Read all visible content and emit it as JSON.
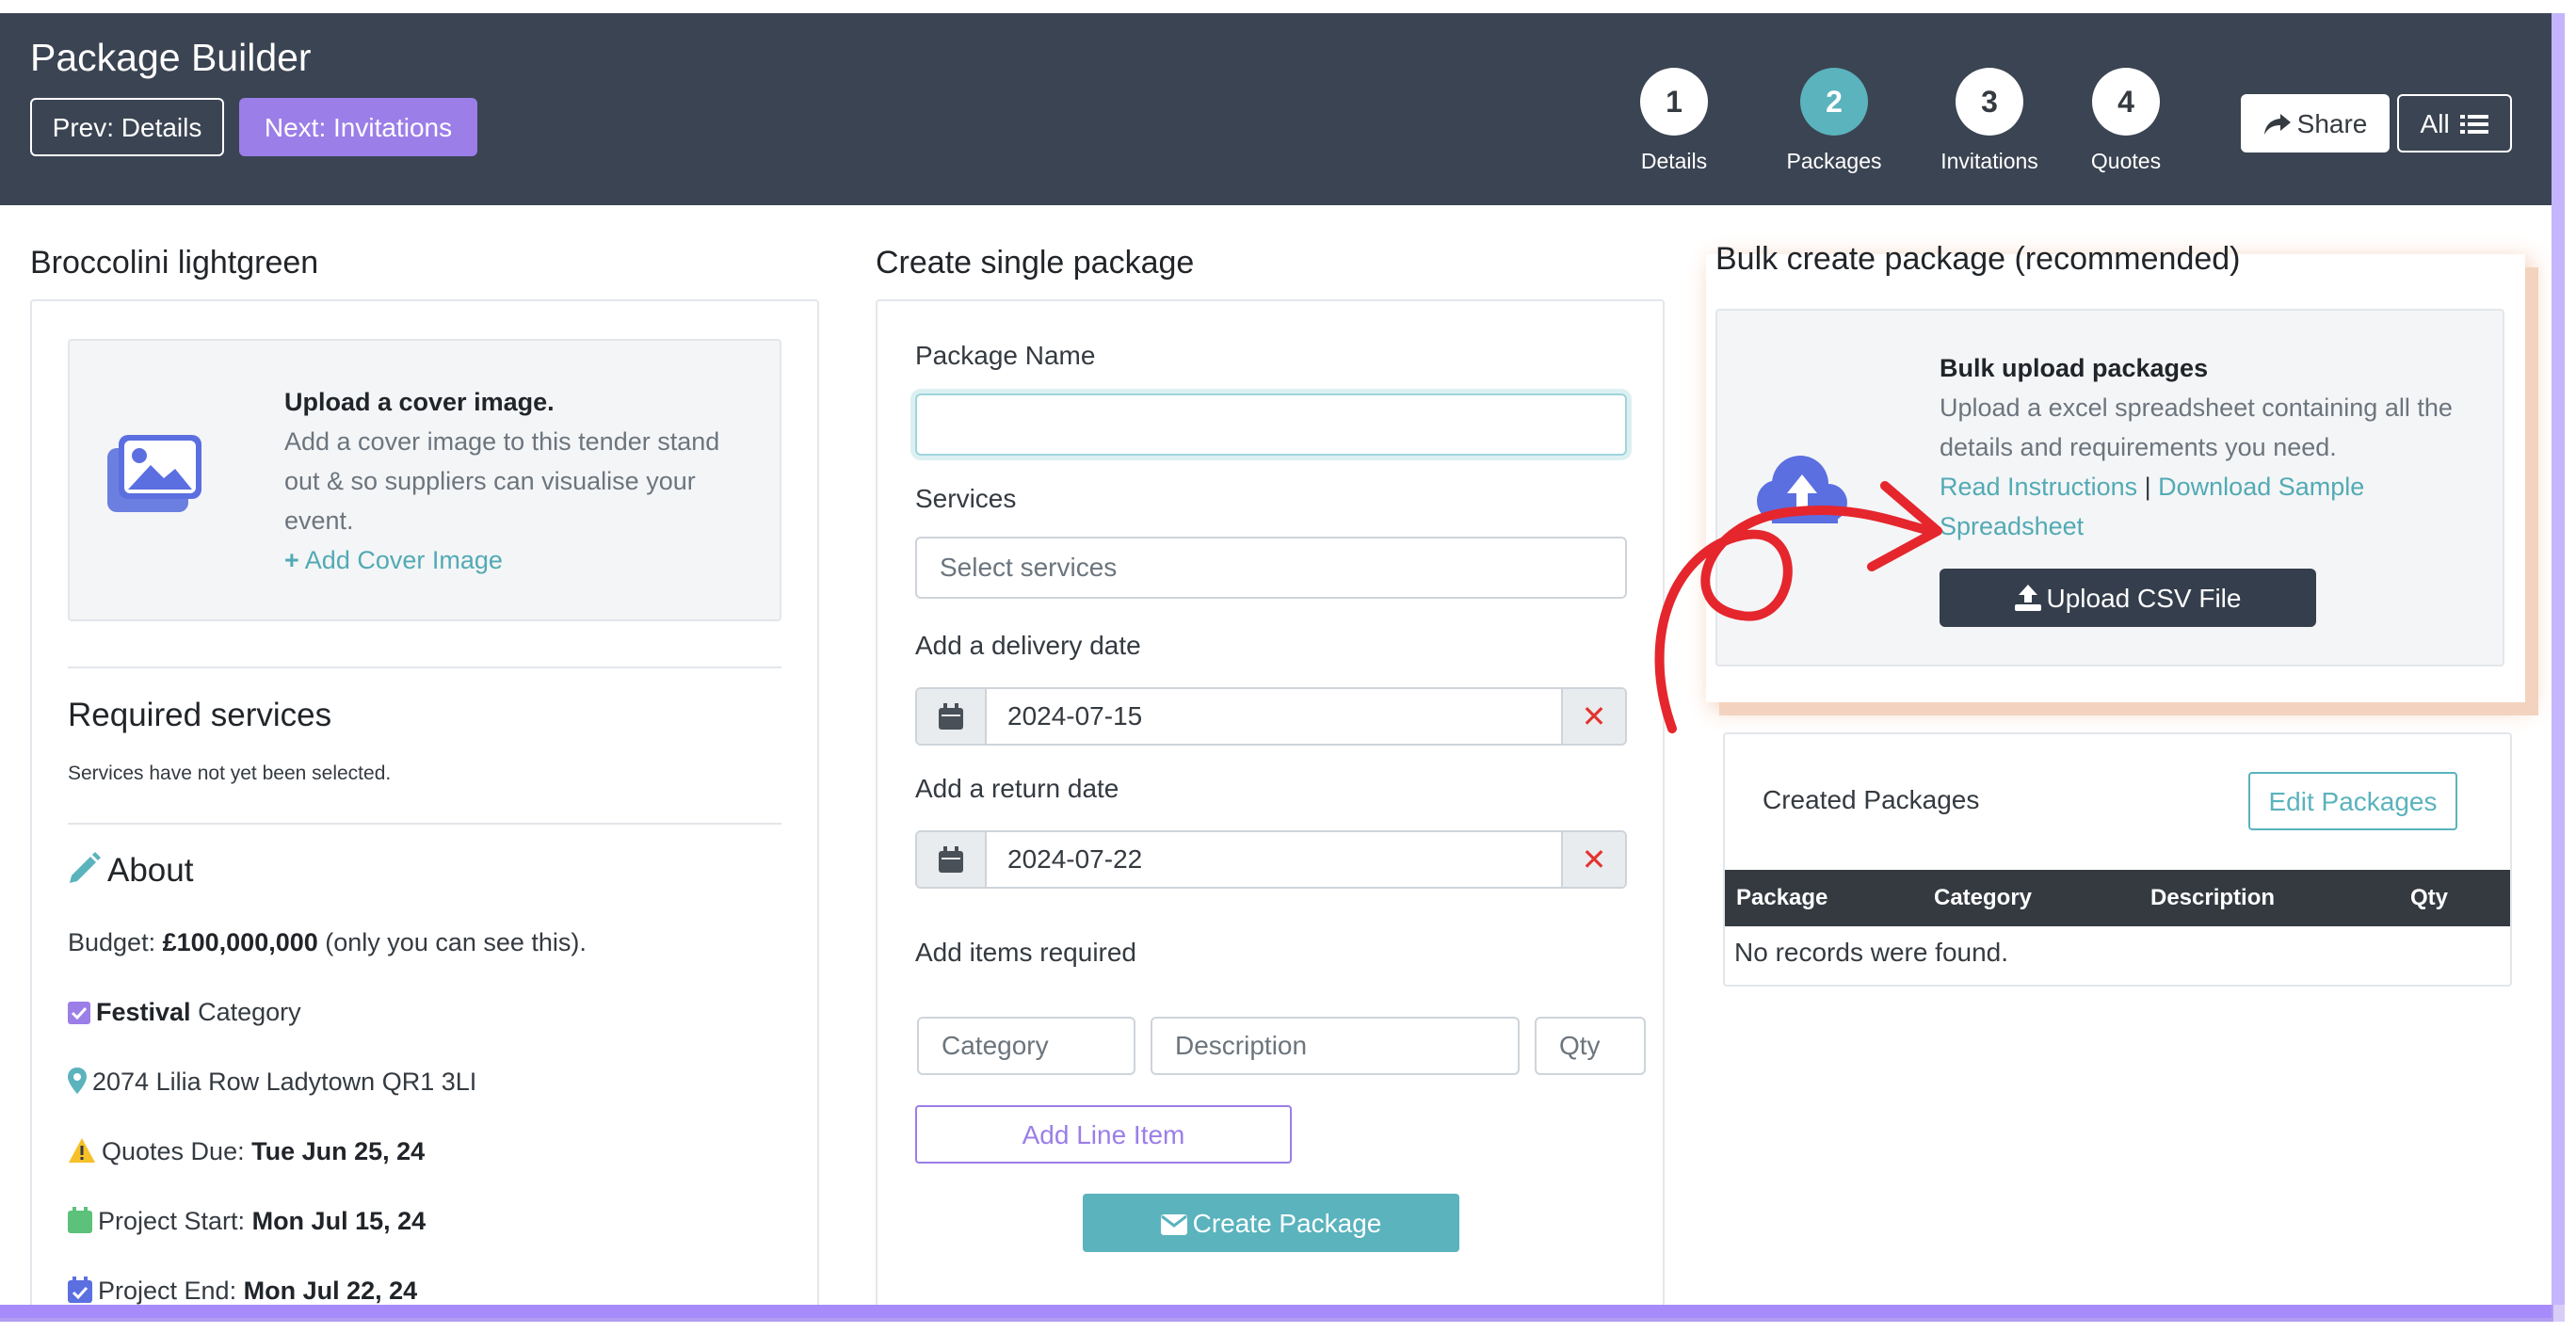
{
  "header": {
    "title": "Package Builder",
    "prev_label": "Prev: Details",
    "next_label": "Next: Invitations",
    "steps": [
      {
        "num": "1",
        "label": "Details"
      },
      {
        "num": "2",
        "label": "Packages"
      },
      {
        "num": "3",
        "label": "Invitations"
      },
      {
        "num": "4",
        "label": "Quotes"
      }
    ],
    "share_label": "Share",
    "all_label": "All"
  },
  "left": {
    "title": "Broccolini lightgreen",
    "cover_heading": "Upload a cover image.",
    "cover_desc": "Add a cover image to this tender stand out & so suppliers can visualise your event.",
    "cover_link": "Add Cover Image",
    "required_title": "Required services",
    "required_note": "Services have not yet been selected.",
    "about_title": "About",
    "budget_prefix": "Budget:",
    "budget_value": "£100,000,000",
    "budget_suffix": "(only you can see this).",
    "category_value": "Festival",
    "category_suffix": "Category",
    "address": "2074 Lilia Row Ladytown QR1 3LI",
    "quotes_label": "Quotes Due:",
    "quotes_value": "Tue Jun 25, 24",
    "start_label": "Project Start:",
    "start_value": "Mon Jul 15, 24",
    "end_label": "Project End:",
    "end_value": "Mon Jul 22, 24"
  },
  "middle": {
    "title": "Create single package",
    "name_label": "Package Name",
    "name_value": "",
    "services_label": "Services",
    "services_placeholder": "Select services",
    "delivery_label": "Add a delivery date",
    "delivery_value": "2024-07-15",
    "return_label": "Add a return date",
    "return_value": "2024-07-22",
    "items_label": "Add items required",
    "category_placeholder": "Category",
    "description_placeholder": "Description",
    "qty_placeholder": "Qty",
    "add_line_label": "Add Line Item",
    "create_label": "Create Package"
  },
  "right": {
    "title": "Bulk create package (recommended)",
    "bulk_heading": "Bulk upload packages",
    "bulk_desc": "Upload a excel spreadsheet containing all the details and requirements you need.",
    "read_link": "Read Instructions",
    "separator": "|",
    "download_link": "Download Sample Spreadsheet",
    "upload_label": "Upload CSV File",
    "created_title": "Created Packages",
    "edit_label": "Edit Packages",
    "columns": [
      "Package",
      "Category",
      "Description",
      "Qty"
    ],
    "empty_text": "No records were found."
  },
  "colors": {
    "header_bg": "#3b4452",
    "accent_teal": "#5ab3bd",
    "accent_purple": "#9b7ee8",
    "annotation_red": "#e5262d"
  }
}
